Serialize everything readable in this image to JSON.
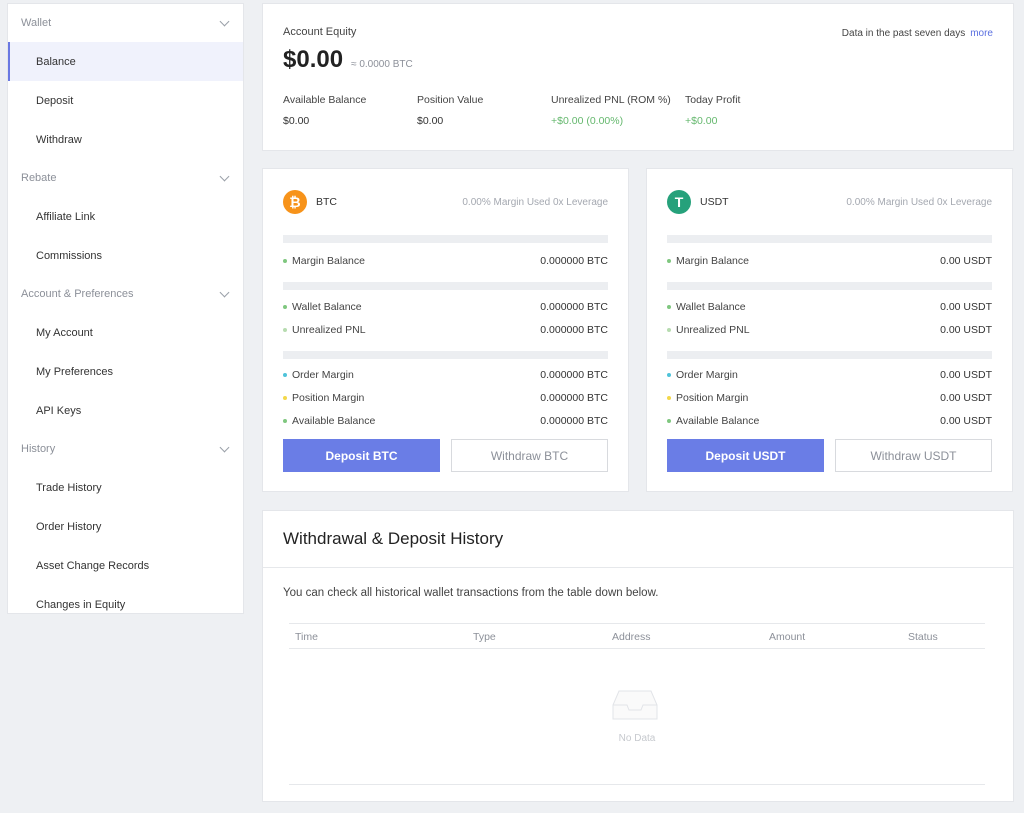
{
  "sidebar": {
    "groups": [
      {
        "title": "Wallet",
        "items": [
          "Balance",
          "Deposit",
          "Withdraw"
        ]
      },
      {
        "title": "Rebate",
        "items": [
          "Affiliate Link",
          "Commissions"
        ]
      },
      {
        "title": "Account & Preferences",
        "items": [
          "My Account",
          "My Preferences",
          "API Keys"
        ]
      },
      {
        "title": "History",
        "items": [
          "Trade History",
          "Order History",
          "Asset Change Records",
          "Changes in Equity"
        ]
      }
    ],
    "active_item": "Balance"
  },
  "equity": {
    "label": "Account Equity",
    "value": "$0.00",
    "btc_equiv": "≈ 0.0000 BTC",
    "period_text": "Data in the past seven days",
    "more_link": "more",
    "stats": [
      {
        "label": "Available Balance",
        "value": "$0.00"
      },
      {
        "label": "Position Value",
        "value": "$0.00"
      },
      {
        "label": "Unrealized PNL (ROM %)",
        "value": "+$0.00 (0.00%)"
      },
      {
        "label": "Today Profit",
        "value": "+$0.00"
      }
    ]
  },
  "assets": [
    {
      "name": "BTC",
      "icon": "bitcoin-icon",
      "margin_info": "0.00% Margin Used 0x Leverage",
      "rows": {
        "margin_balance": {
          "label": "Margin Balance",
          "value": "0.000000 BTC"
        },
        "wallet_balance": {
          "label": "Wallet Balance",
          "value": "0.000000 BTC"
        },
        "unrealized_pnl": {
          "label": "Unrealized PNL",
          "value": "0.000000 BTC"
        },
        "order_margin": {
          "label": "Order Margin",
          "value": "0.000000 BTC"
        },
        "position_margin": {
          "label": "Position Margin",
          "value": "0.000000 BTC"
        },
        "available_balance": {
          "label": "Available Balance",
          "value": "0.000000 BTC"
        }
      },
      "deposit_label": "Deposit BTC",
      "withdraw_label": "Withdraw BTC"
    },
    {
      "name": "USDT",
      "icon": "tether-icon",
      "margin_info": "0.00% Margin Used 0x Leverage",
      "rows": {
        "margin_balance": {
          "label": "Margin Balance",
          "value": "0.00 USDT"
        },
        "wallet_balance": {
          "label": "Wallet Balance",
          "value": "0.00 USDT"
        },
        "unrealized_pnl": {
          "label": "Unrealized PNL",
          "value": "0.00 USDT"
        },
        "order_margin": {
          "label": "Order Margin",
          "value": "0.00 USDT"
        },
        "position_margin": {
          "label": "Position Margin",
          "value": "0.00 USDT"
        },
        "available_balance": {
          "label": "Available Balance",
          "value": "0.00 USDT"
        }
      },
      "deposit_label": "Deposit USDT",
      "withdraw_label": "Withdraw USDT"
    }
  ],
  "history": {
    "title": "Withdrawal & Deposit History",
    "description": "You can check all historical wallet transactions from the table down below.",
    "columns": [
      "Time",
      "Type",
      "Address",
      "Amount",
      "Status"
    ],
    "empty_text": "No Data"
  },
  "colors": {
    "accent": "#6a7de6",
    "positive": "#65b86e",
    "btc": "#f7931a",
    "usdt": "#26a17b",
    "dot_green": "#7fc77f",
    "dot_light_green": "#b7dcb0",
    "dot_cyan": "#4fc3d9",
    "dot_yellow": "#f3d84a"
  }
}
